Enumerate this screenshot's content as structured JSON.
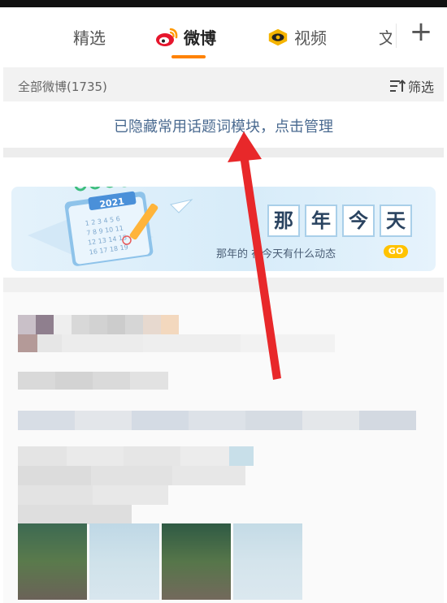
{
  "tabs": [
    {
      "label": "精选",
      "active": false,
      "icon": null
    },
    {
      "label": "微博",
      "active": true,
      "icon": "weibo-logo-icon"
    },
    {
      "label": "视频",
      "active": false,
      "icon": "video-eye-icon"
    },
    {
      "label": "文",
      "active": false,
      "icon": null
    }
  ],
  "add_tab_label": "+",
  "filter": {
    "count_label": "全部微博(1735)",
    "filter_label": "筛选",
    "filter_icon": "filter-icon"
  },
  "notice": {
    "text": "已隐藏常用话题词模块，点击管理"
  },
  "banner": {
    "title_chars": [
      "那",
      "年",
      "今",
      "天"
    ],
    "subtitle": "那年的  在今天有什么动态",
    "go_label": "GO",
    "calendar_year": "2021"
  },
  "colors": {
    "accent": "#ff8200",
    "notice_text": "#4a6a90",
    "annotation_arrow": "#e8282a"
  }
}
